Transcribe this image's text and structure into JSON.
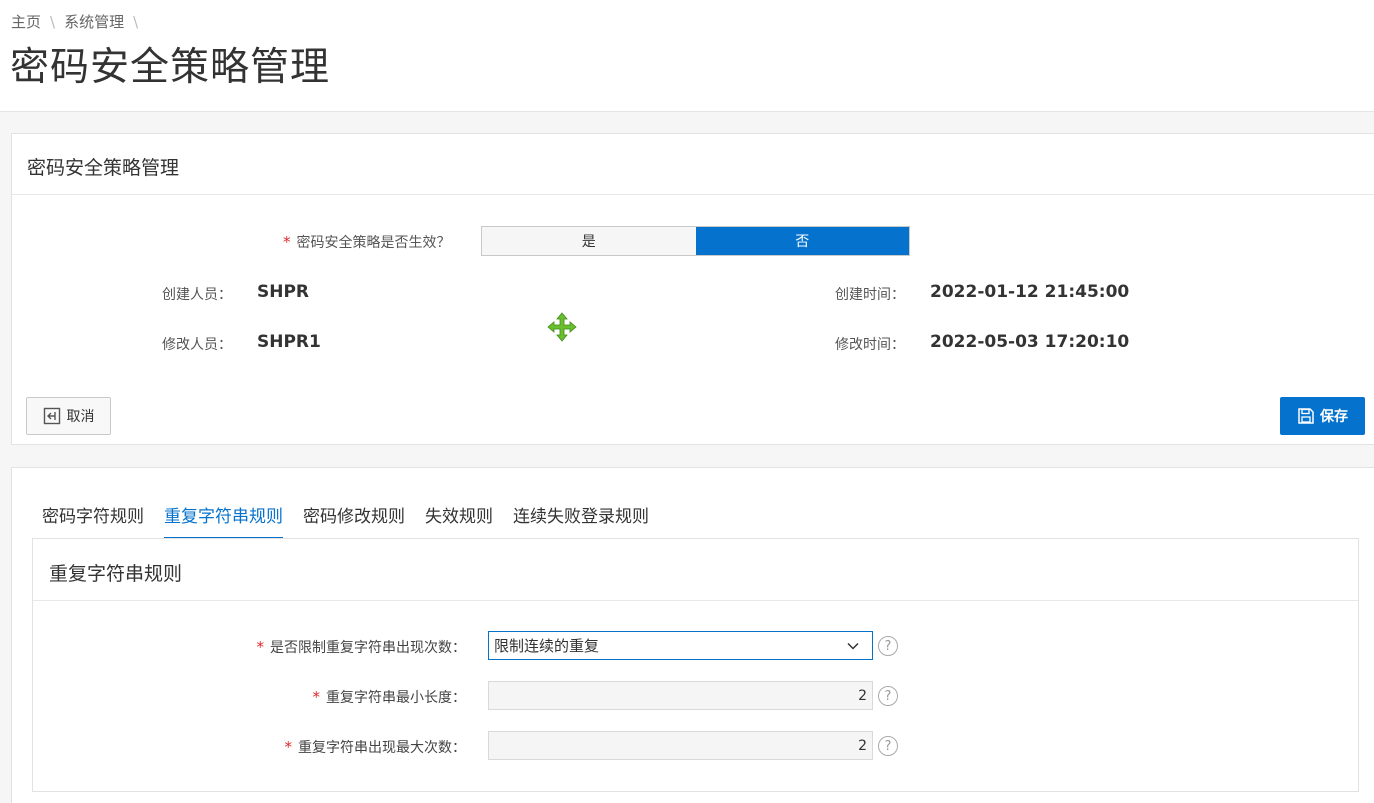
{
  "breadcrumb": {
    "home": "主页",
    "sep": "\\",
    "system": "系统管理"
  },
  "page_title": "密码安全策略管理",
  "panel": {
    "title": "密码安全策略管理",
    "toggle_label": "密码安全策略是否生效？",
    "required_mark": "*",
    "toggle_yes": "是",
    "toggle_no": "否",
    "toggle_selected": "否",
    "created_by_label": "创建人员：",
    "created_by": "SHPR",
    "modified_by_label": "修改人员：",
    "modified_by": "SHPR1",
    "created_time_label": "创建时间：",
    "created_time": "2022-01-12 21:45:00",
    "modified_time_label": "修改时间：",
    "modified_time": "2022-05-03 17:20:10",
    "cancel_label": "取消",
    "save_label": "保存"
  },
  "tabs": [
    {
      "label": "密码字符规则",
      "active": false
    },
    {
      "label": "重复字符串规则",
      "active": true
    },
    {
      "label": "密码修改规则",
      "active": false
    },
    {
      "label": "失效规则",
      "active": false
    },
    {
      "label": "连续失败登录规则",
      "active": false
    }
  ],
  "repeat_rules": {
    "title": "重复字符串规则",
    "limit_label": "是否限制重复字符串出现次数：",
    "limit_value": "限制连续的重复",
    "min_len_label": "重复字符串最小长度：",
    "min_len_value": "2",
    "max_count_label": "重复字符串出现最大次数：",
    "max_count_value": "2",
    "help_glyph": "?"
  },
  "colors": {
    "accent": "#0572ce",
    "required": "#e0272d",
    "move_icon": "#6abf2e"
  }
}
